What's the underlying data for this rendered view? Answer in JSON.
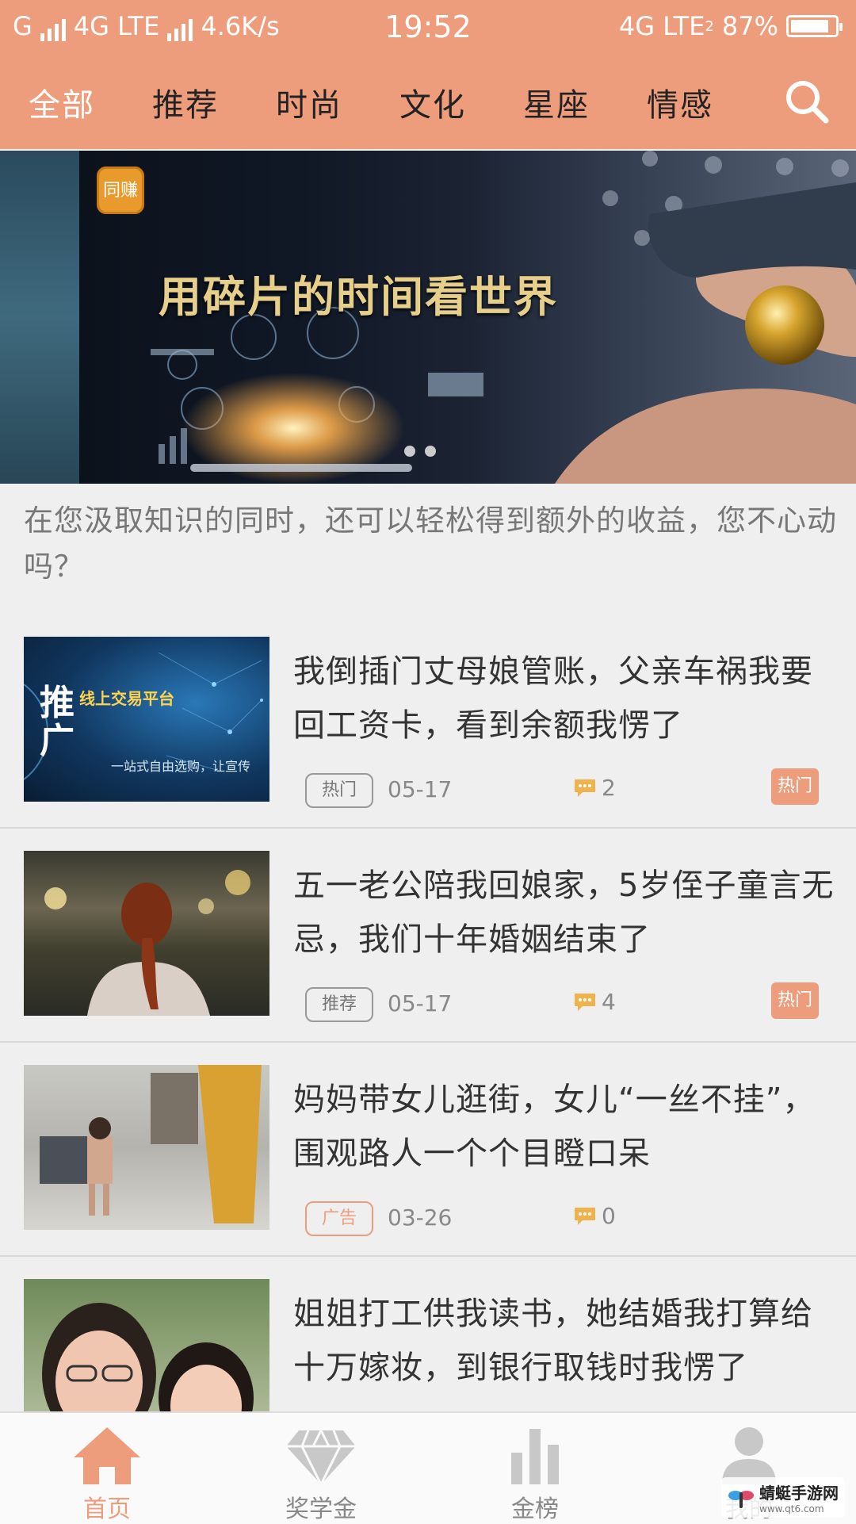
{
  "status": {
    "carrier1": "G",
    "network1": "4G LTE",
    "speed": "4.6K/s",
    "time": "19:52",
    "network2": "4G LTE",
    "sim2": "2",
    "battery": "87%",
    "battery_level": 0.87
  },
  "tabs": [
    "全部",
    "推荐",
    "时尚",
    "文化",
    "星座",
    "情感"
  ],
  "active_tab": "全部",
  "banner": {
    "logo_text": "同赚",
    "slogan": "用碎片的时间看世界"
  },
  "intro": "在您汲取知识的同时，还可以轻松得到额外的收益，您不心动吗？",
  "articles": [
    {
      "title": "我倒插门丈母娘管账，父亲车祸我要回工资卡，看到余额我愣了",
      "tag": "热门",
      "date": "05-17",
      "comments": "2",
      "hot_badge": "热门",
      "thumb_text": {
        "main": "推广",
        "side": "线上交易平台",
        "sub": "一站式自由选购，让宣传"
      }
    },
    {
      "title": "五一老公陪我回娘家，5岁侄子童言无忌，我们十年婚姻结束了",
      "tag": "推荐",
      "date": "05-17",
      "comments": "4",
      "hot_badge": "热门"
    },
    {
      "title": "妈妈带女儿逛街，女儿“一丝不挂”，围观路人一个个目瞪口呆",
      "tag": "广告",
      "date": "03-26",
      "comments": "0"
    },
    {
      "title": "姐姐打工供我读书，她结婚我打算给十万嫁妆，到银行取钱时我愣了"
    }
  ],
  "bottom_nav": [
    "首页",
    "奖学金",
    "金榜",
    "我的"
  ],
  "watermark": {
    "name": "蜻蜓手游网",
    "url": "www.qt6.com"
  },
  "colors": {
    "accent": "#ee9d7c",
    "background": "#efefef"
  }
}
